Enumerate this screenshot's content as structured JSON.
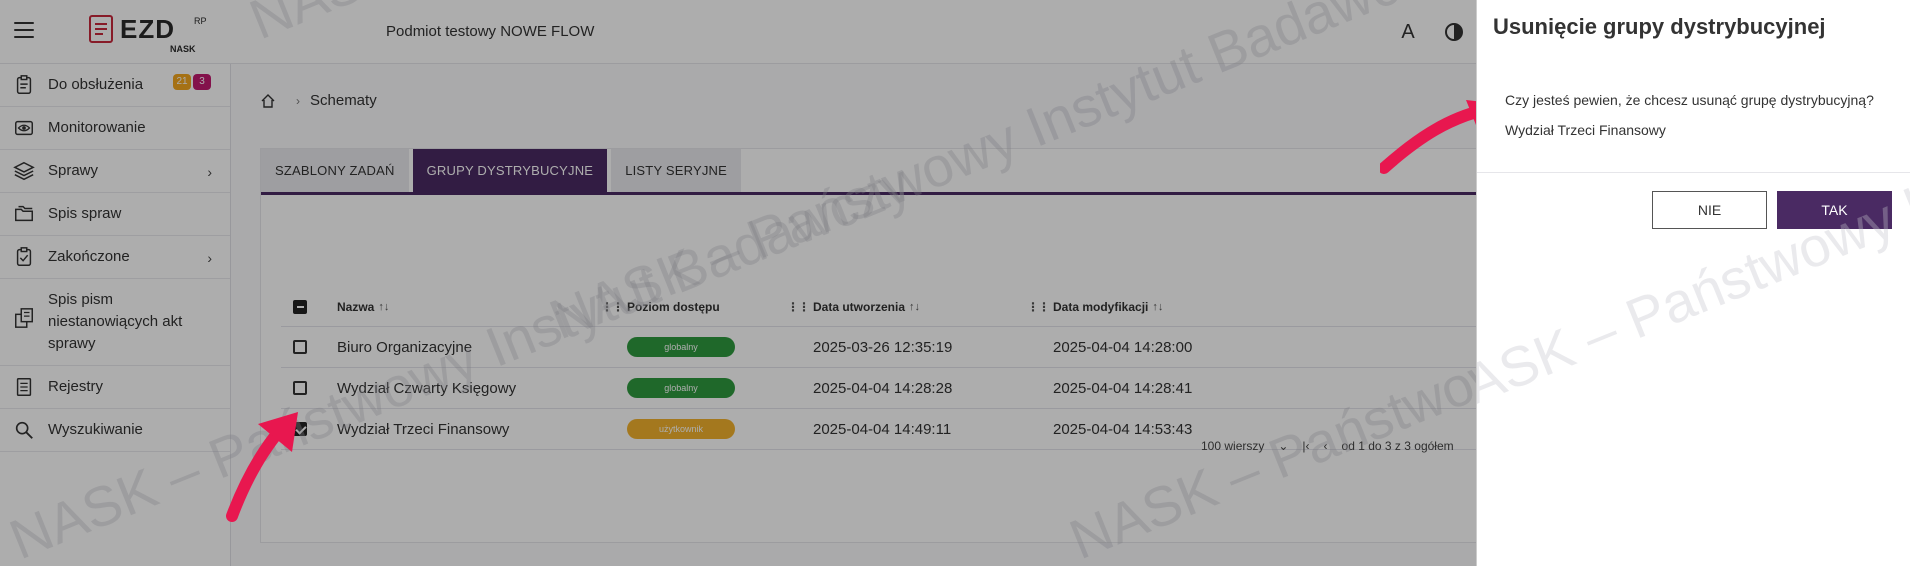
{
  "topbar": {
    "logo_text": "EZD",
    "logo_superscript": "RP",
    "logo_subtext": "NASK",
    "org_name": "Podmiot testowy NOWE FLOW",
    "font_size_icon_label": "A",
    "icons": [
      "hamburger-icon",
      "font-size-icon",
      "contrast-icon"
    ]
  },
  "sidebar": {
    "items": [
      {
        "label": "Do obsłużenia",
        "icon": "clipboard-icon",
        "badges": [
          "21",
          "3"
        ]
      },
      {
        "label": "Monitorowanie",
        "icon": "eye-icon"
      },
      {
        "label": "Sprawy",
        "icon": "layers-icon",
        "chevron": "›"
      },
      {
        "label": "Spis spraw",
        "icon": "folders-icon"
      },
      {
        "label": "Zakończone",
        "icon": "clipboard-check-icon",
        "chevron": "›"
      },
      {
        "label": "Spis pism niestanowiących akt sprawy",
        "icon": "documents-icon"
      },
      {
        "label": "Rejestry",
        "icon": "register-icon"
      },
      {
        "label": "Wyszukiwanie",
        "icon": "search-icon"
      }
    ]
  },
  "breadcrumb": {
    "current": "Schematy",
    "separator": "›"
  },
  "tabs": [
    {
      "label": "SZABLONY ZADAŃ",
      "active": false
    },
    {
      "label": "GRUPY DYSTRYBUCYJNE",
      "active": true
    },
    {
      "label": "LISTY SERYJNE",
      "active": false
    }
  ],
  "table": {
    "columns": [
      "Nazwa",
      "Poziom dostępu",
      "Data utworzenia",
      "Data modyfikacji"
    ],
    "sort_glyph": "↑↓",
    "drag_glyph": "⋮⋮",
    "rows": [
      {
        "name": "Biuro Organizacyjne",
        "access": "globalny",
        "access_color": "#2f9a3f",
        "created": "2025-03-26 12:35:19",
        "modified": "2025-04-04 14:28:00",
        "checked": false
      },
      {
        "name": "Wydział Czwarty Księgowy",
        "access": "globalny",
        "access_color": "#2f9a3f",
        "created": "2025-04-04 14:28:28",
        "modified": "2025-04-04 14:28:41",
        "checked": false
      },
      {
        "name": "Wydział Trzeci Finansowy",
        "access": "użytkownik",
        "access_color": "#f2b22d",
        "created": "2025-04-04 14:49:11",
        "modified": "2025-04-04 14:53:43",
        "checked": true
      }
    ],
    "pager": {
      "rows_per_page": "100 wierszy",
      "range": "od 1 do 3 z 3 ogółem"
    }
  },
  "dialog": {
    "title": "Usunięcie grupy dystrybucyjnej",
    "question": "Czy jesteś pewien, że chcesz usunąć grupę dystrybucyjną?",
    "group_name": "Wydział Trzeci Finansowy",
    "no_label": "NIE",
    "yes_label": "TAK"
  },
  "watermark": {
    "text": "NASK – Państwowy Instytut Badawczy"
  },
  "colors": {
    "primary": "#4a2a63",
    "annotation_arrow": "#e8174f",
    "badge_orange": "#f3a71f",
    "badge_pink": "#c21a6f"
  }
}
